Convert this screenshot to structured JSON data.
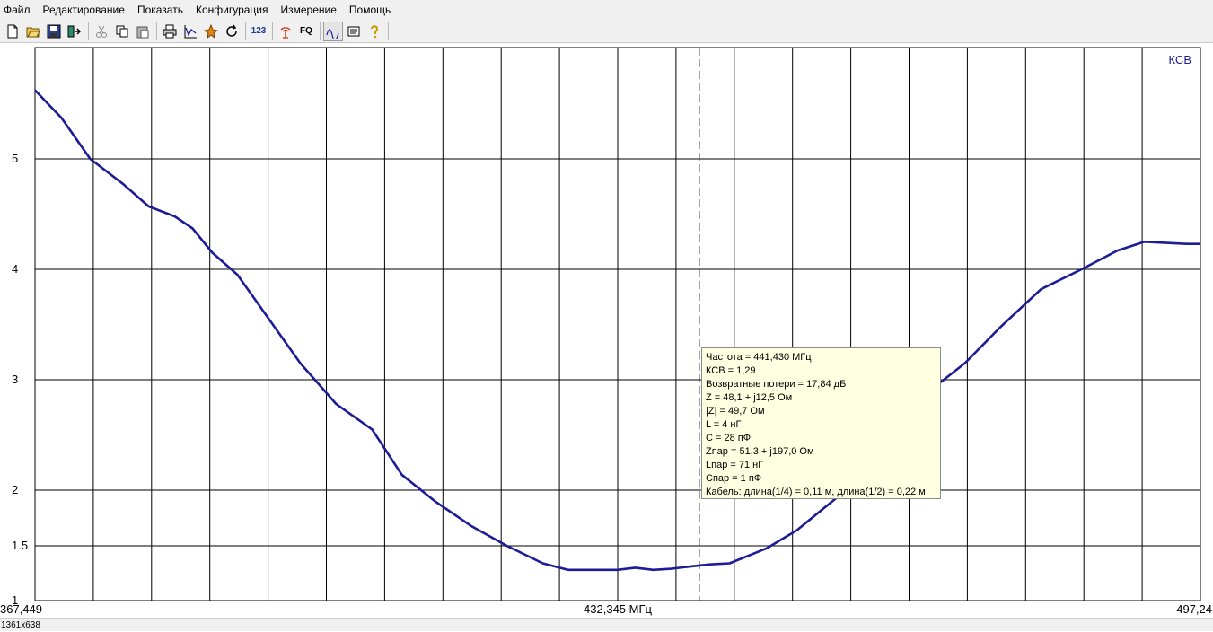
{
  "menu": [
    "Файл",
    "Редактирование",
    "Показать",
    "Конфигурация",
    "Измерение",
    "Помощь"
  ],
  "toolbar": {
    "buttons": [
      {
        "name": "new-file-icon"
      },
      {
        "name": "open-folder-icon"
      },
      {
        "name": "save-disk-icon"
      },
      {
        "name": "export-icon"
      },
      {
        "name": "cut-icon"
      },
      {
        "name": "copy-icon"
      },
      {
        "name": "paste-icon"
      },
      {
        "name": "print-icon"
      },
      {
        "name": "graph-icon"
      },
      {
        "name": "settings-star-icon"
      },
      {
        "name": "refresh-icon"
      },
      {
        "name": "numbers-icon",
        "text": "123"
      },
      {
        "name": "antenna-icon"
      },
      {
        "name": "fq-icon",
        "text": "FQ"
      },
      {
        "name": "scale-icon"
      },
      {
        "name": "notes-icon"
      },
      {
        "name": "help-icon"
      }
    ]
  },
  "chart_data": {
    "type": "line",
    "title": "КСВ",
    "ylabel": "КСВ",
    "ylim": [
      1,
      5.6
    ],
    "yticks": [
      "1",
      "1.5",
      "2",
      "3",
      "4",
      "5"
    ],
    "x_left_label": "367,449",
    "x_center_label": "432,345 МГц",
    "x_right_label": "497,24",
    "xlim": [
      367.449,
      497.24
    ],
    "series": [
      {
        "color": "#1c1c96",
        "x": [
          367.45,
          370.4,
          373.6,
          377.3,
          380.1,
          383.0,
          385.0,
          387.2,
          390.0,
          393.5,
          397.0,
          401.0,
          405.0,
          408.3,
          412.0,
          416.0,
          420.0,
          424.0,
          426.8,
          429.7,
          432.3,
          434.3,
          436.3,
          438.3,
          440.3,
          442.6,
          444.8,
          447.2,
          449.0,
          452.3,
          457.0,
          462.0,
          466.0,
          471.0,
          475.0,
          479.5,
          484.0,
          488.0,
          491.0,
          495.7,
          497.24
        ],
        "y": [
          5.62,
          5.37,
          5.0,
          4.77,
          4.57,
          4.48,
          4.37,
          4.15,
          3.95,
          3.55,
          3.15,
          2.78,
          2.55,
          2.14,
          1.9,
          1.68,
          1.5,
          1.34,
          1.28,
          1.28,
          1.28,
          1.3,
          1.28,
          1.29,
          1.31,
          1.33,
          1.34,
          1.42,
          1.48,
          1.64,
          1.95,
          2.45,
          2.83,
          3.15,
          3.48,
          3.82,
          4.0,
          4.17,
          4.25,
          4.23,
          4.23
        ]
      }
    ],
    "marker_x": 441.43,
    "grid": true
  },
  "tooltip": {
    "lines": [
      "Частота = 441,430 МГц",
      "КСВ = 1,29",
      "Возвратные потери = 17,84 дБ",
      "Z = 48,1 + j12,5 Ом",
      "|Z| = 49,7 Ом",
      "L = 4 нГ",
      "C = 28 пФ",
      "Zпар = 51,3 + j197,0 Ом",
      "Lпар = 71 нГ",
      "Cпар = 1 пФ",
      "Кабель: длина(1/4) = 0,11 м, длина(1/2) = 0,22 м"
    ]
  },
  "status": "1361x638"
}
